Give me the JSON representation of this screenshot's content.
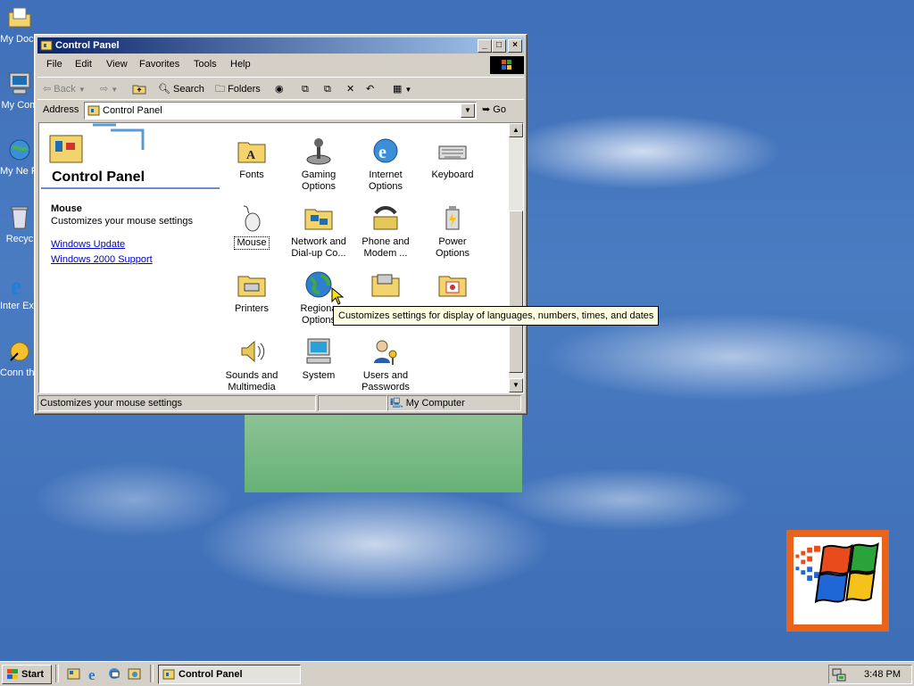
{
  "desktop": {
    "icons": [
      {
        "label": "My Docu",
        "icon": "my-documents-icon"
      },
      {
        "label": "My Com",
        "icon": "my-computer-icon"
      },
      {
        "label": "My Ne Plac",
        "icon": "network-places-icon"
      },
      {
        "label": "Recyc",
        "icon": "recycle-bin-icon"
      },
      {
        "label": "Inter Explo",
        "icon": "internet-explorer-icon"
      },
      {
        "label": "Conn the In",
        "icon": "connect-internet-icon"
      }
    ]
  },
  "window": {
    "title": "Control Panel",
    "menu": [
      "File",
      "Edit",
      "View",
      "Favorites",
      "Tools",
      "Help"
    ],
    "toolbar": {
      "back": "Back",
      "search": "Search",
      "folders": "Folders"
    },
    "address": {
      "label": "Address",
      "value": "Control Panel",
      "go": "Go"
    },
    "left_pane": {
      "title": "Control Panel",
      "selected_title": "Mouse",
      "selected_desc": "Customizes your mouse settings",
      "links": [
        "Windows Update",
        "Windows 2000 Support"
      ]
    },
    "items": [
      {
        "label": "Fonts",
        "icon": "fonts-icon"
      },
      {
        "label": "Gaming Options",
        "icon": "gaming-options-icon"
      },
      {
        "label": "Internet Options",
        "icon": "internet-options-icon"
      },
      {
        "label": "Keyboard",
        "icon": "keyboard-icon"
      },
      {
        "label": "Mouse",
        "icon": "mouse-icon"
      },
      {
        "label": "Network and Dial-up Co...",
        "icon": "network-icon"
      },
      {
        "label": "Phone and Modem ...",
        "icon": "phone-modem-icon"
      },
      {
        "label": "Power Options",
        "icon": "power-options-icon"
      },
      {
        "label": "Printers",
        "icon": "printers-icon"
      },
      {
        "label": "Regiona Options",
        "icon": "regional-options-icon"
      },
      {
        "label": "",
        "icon": "scanners-cameras-icon"
      },
      {
        "label": "",
        "icon": "scheduled-tasks-icon"
      },
      {
        "label": "Sounds and Multimedia",
        "icon": "sounds-icon"
      },
      {
        "label": "System",
        "icon": "system-icon"
      },
      {
        "label": "Users and Passwords",
        "icon": "users-icon"
      }
    ],
    "tooltip": "Customizes settings for display of languages, numbers, times, and dates",
    "status": {
      "text": "Customizes your mouse settings",
      "zone": "My Computer"
    }
  },
  "taskbar": {
    "start": "Start",
    "task": "Control Panel",
    "clock": "3:48 PM"
  }
}
